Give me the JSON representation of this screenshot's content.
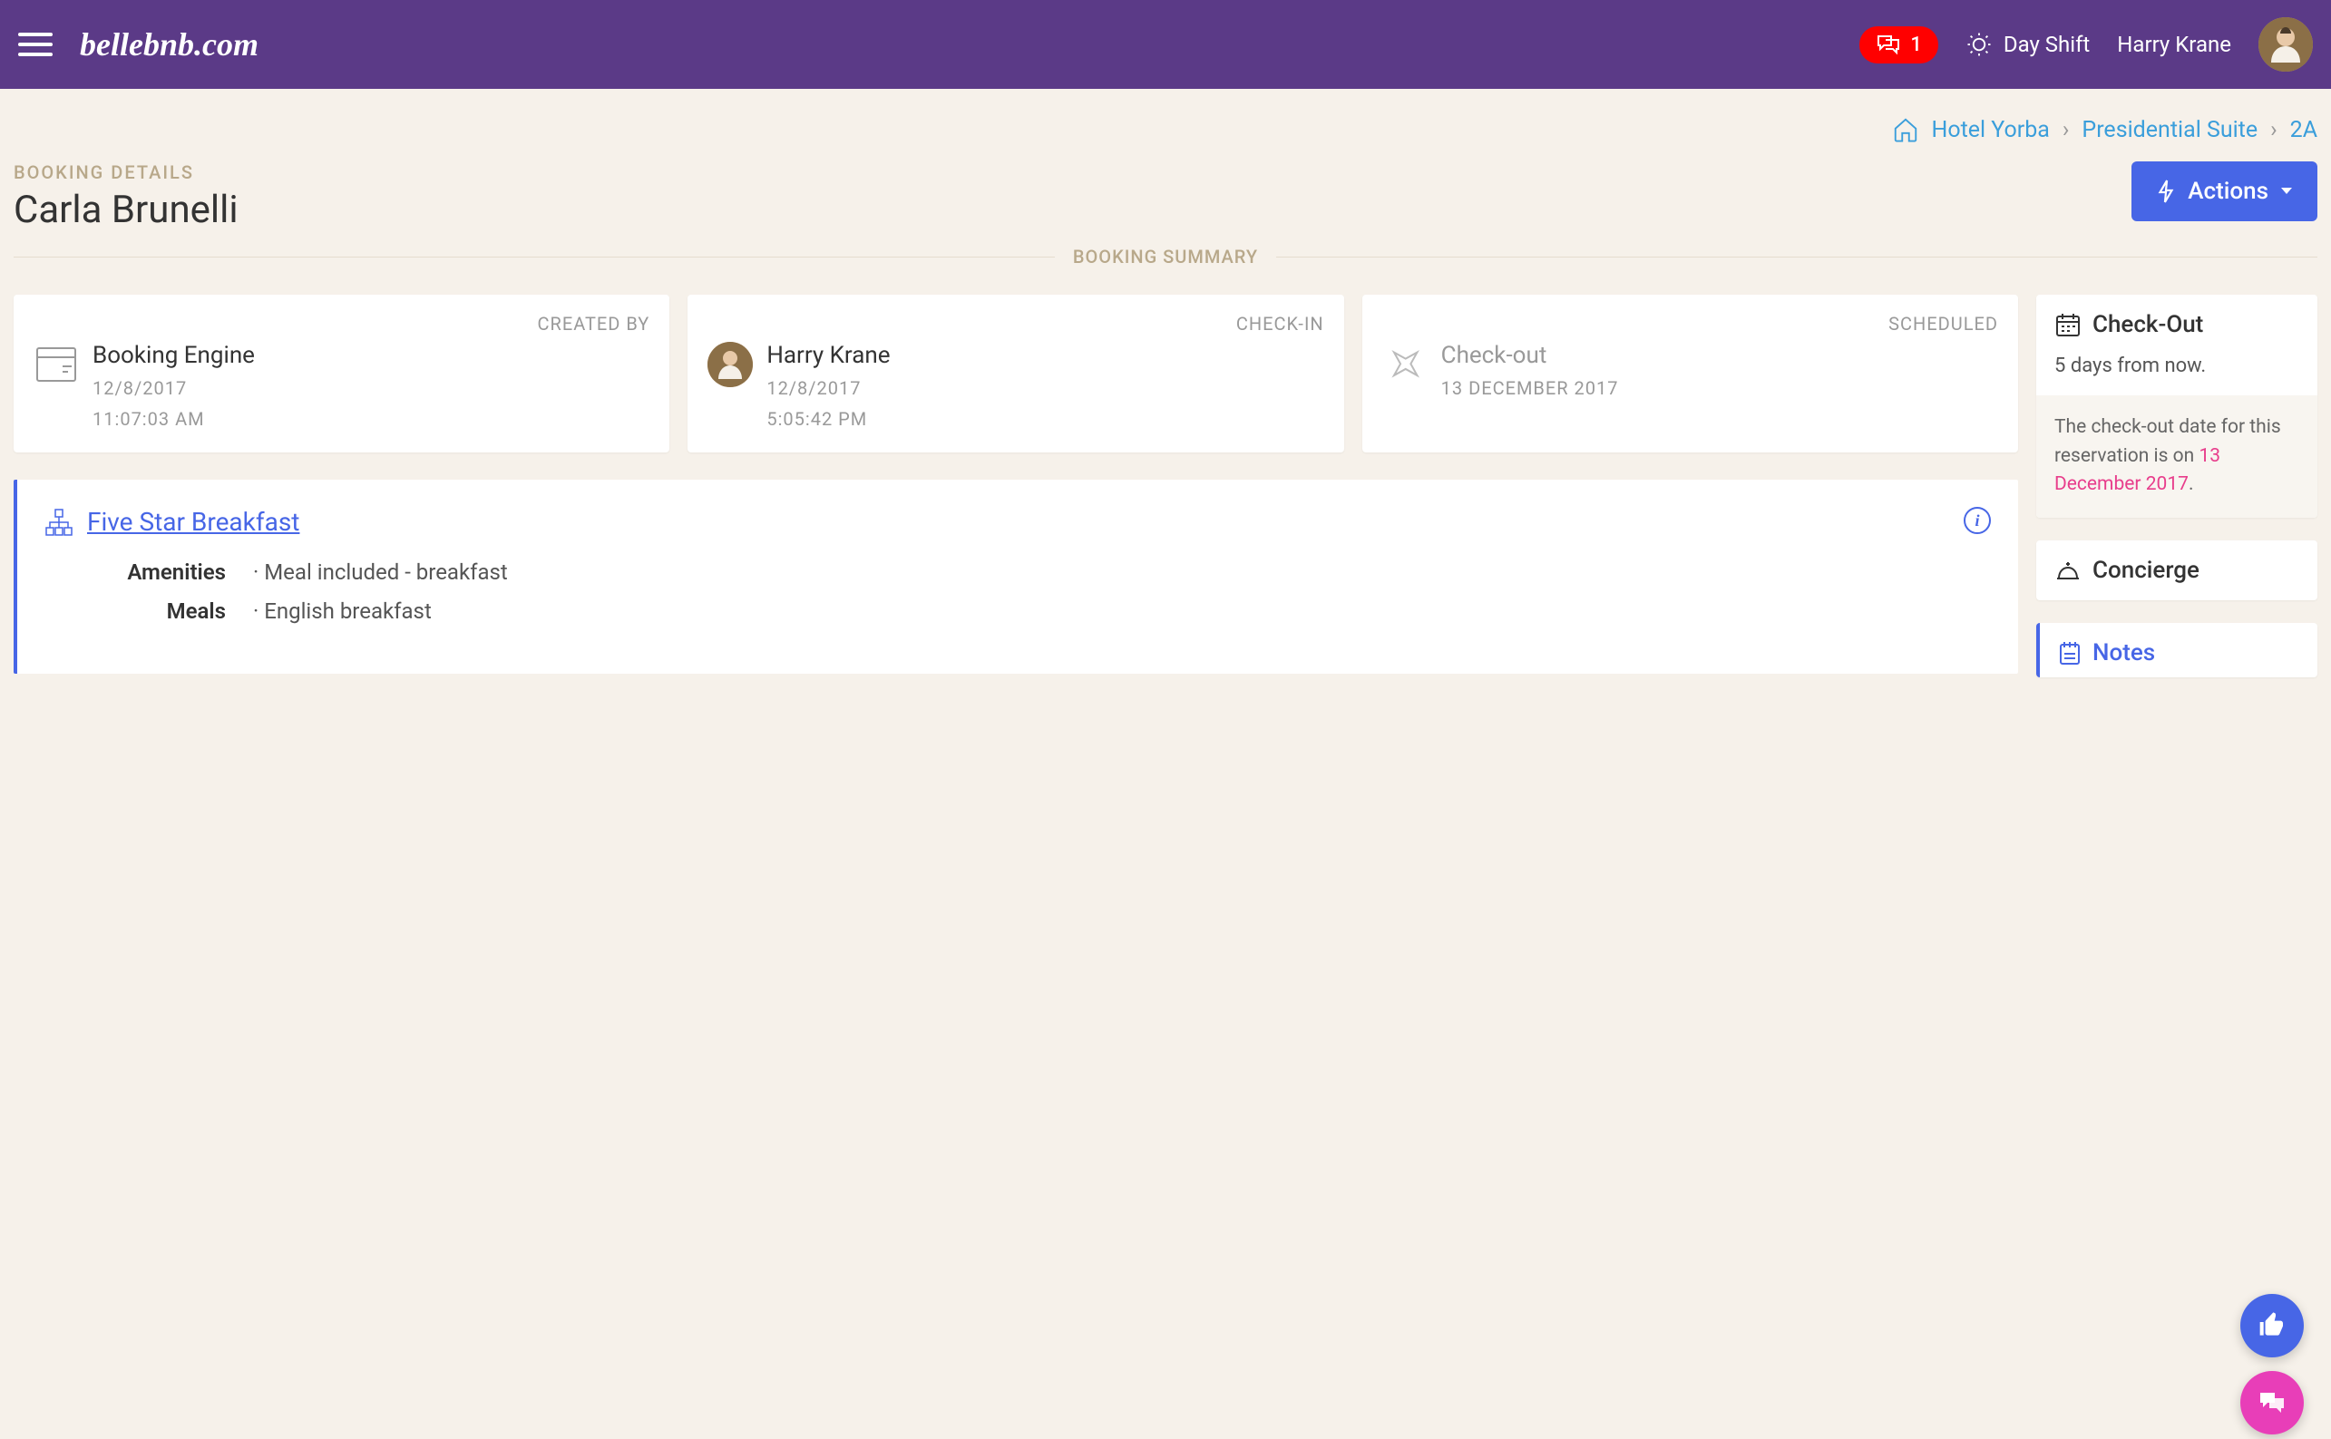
{
  "header": {
    "logo": "bellebnb.com",
    "notification_count": "1",
    "shift_label": "Day Shift",
    "username": "Harry Krane"
  },
  "breadcrumb": {
    "hotel": "Hotel Yorba",
    "suite": "Presidential Suite",
    "room": "2A"
  },
  "page": {
    "label": "BOOKING DETAILS",
    "title": "Carla Brunelli",
    "actions_label": "Actions",
    "summary_label": "BOOKING SUMMARY"
  },
  "cards": {
    "created": {
      "label": "CREATED BY",
      "title": "Booking Engine",
      "date": "12/8/2017",
      "time": "11:07:03 AM"
    },
    "checkin": {
      "label": "CHECK-IN",
      "title": "Harry Krane",
      "date": "12/8/2017",
      "time": "5:05:42 PM"
    },
    "scheduled": {
      "label": "SCHEDULED",
      "title": "Check-out",
      "date": "13 DECEMBER 2017"
    }
  },
  "package": {
    "title": "Five Star Breakfast",
    "amenities_label": "Amenities",
    "amenities_value": "· Meal included - breakfast",
    "meals_label": "Meals",
    "meals_value": "· English breakfast"
  },
  "sidebar": {
    "checkout": {
      "title": "Check-Out",
      "body": "5 days from now.",
      "footer_prefix": "The check-out date for this reservation is on ",
      "footer_date": "13 December 2017",
      "footer_suffix": "."
    },
    "concierge": {
      "title": "Concierge"
    },
    "notes": {
      "title": "Notes"
    }
  }
}
